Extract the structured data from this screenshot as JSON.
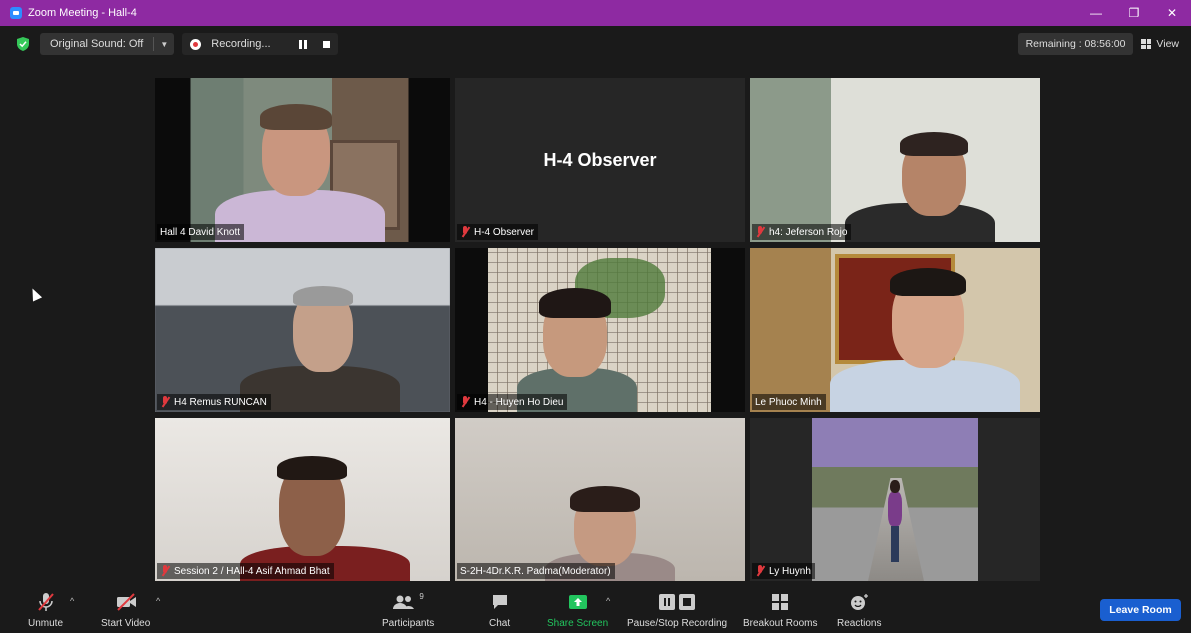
{
  "window": {
    "title": "Zoom Meeting - Hall-4",
    "minimize_glyph": "—",
    "restore_glyph": "❐",
    "close_glyph": "✕"
  },
  "topbar": {
    "sound_label": "Original Sound: Off",
    "recording_label": "Recording...",
    "remaining_label": "Remaining : 08:56:00",
    "view_label": "View"
  },
  "participants": [
    {
      "name": "Hall 4 David Knott",
      "muted": false,
      "active_speaker": true
    },
    {
      "name": "H-4 Observer",
      "muted": true,
      "video": false,
      "center_label": "H-4 Observer"
    },
    {
      "name": "h4: Jeferson Rojo",
      "muted": true
    },
    {
      "name": "H4 Remus RUNCAN",
      "muted": true
    },
    {
      "name": "H4 - Huyen Ho Dieu",
      "muted": true
    },
    {
      "name": "Le Phuoc Minh",
      "muted": false
    },
    {
      "name": "Session 2 / HAll-4  Asif Ahmad Bhat",
      "muted": true
    },
    {
      "name": "S-2H-4Dr.K.R. Padma(Moderator)",
      "muted": false
    },
    {
      "name": "Ly Huynh",
      "muted": true
    }
  ],
  "toolbar": {
    "unmute_label": "Unmute",
    "start_video_label": "Start Video",
    "participants_label": "Participants",
    "participants_count": "9",
    "chat_label": "Chat",
    "share_screen_label": "Share Screen",
    "pause_stop_label": "Pause/Stop Recording",
    "breakout_label": "Breakout Rooms",
    "reactions_label": "Reactions",
    "leave_label": "Leave Room"
  },
  "colors": {
    "title_bar": "#8e2aa2",
    "active_speaker_border": "#d7e65a",
    "share_screen_green": "#22c55e",
    "leave_button": "#1a5fd0",
    "muted_red": "#e0393e"
  }
}
